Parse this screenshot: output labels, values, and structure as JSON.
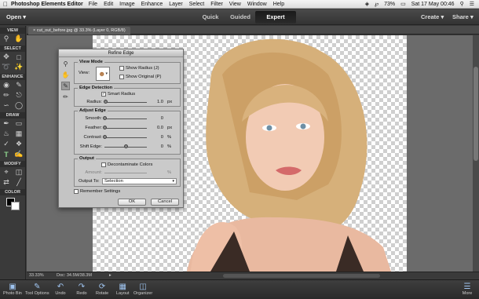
{
  "menubar": {
    "app_name": "Photoshop Elements Editor",
    "items": [
      "File",
      "Edit",
      "Image",
      "Enhance",
      "Layer",
      "Select",
      "Filter",
      "View",
      "Window",
      "Help"
    ],
    "battery": "73%",
    "datetime": "Sat 17 May  00:46"
  },
  "topbar": {
    "open_label": "Open",
    "modes": [
      "Quick",
      "Guided",
      "Expert"
    ],
    "active_mode": "Expert",
    "create_label": "Create",
    "share_label": "Share"
  },
  "tools": {
    "sections": {
      "view": "VIEW",
      "select": "SELECT",
      "enhance": "ENHANCE",
      "draw": "DRAW",
      "modify": "MODIFY",
      "color": "COLOR"
    }
  },
  "document": {
    "tab_title": "cut_out_before.jpg @ 33.3% (Layer 0, RGB/8)"
  },
  "status": {
    "zoom": "33.33%",
    "doc_size": "Doc: 34.5M/38.3M"
  },
  "taskbar": {
    "items": [
      "Photo Bin",
      "Tool Options",
      "Undo",
      "Redo",
      "Rotate",
      "Layout",
      "Organizer"
    ],
    "more": "More"
  },
  "dialog": {
    "title": "Refine Edge",
    "view_mode": {
      "heading": "View Mode",
      "view_label": "View:",
      "show_radius": "Show Radius (J)",
      "show_original": "Show Original (P)"
    },
    "edge_detection": {
      "heading": "Edge Detection",
      "smart_radius": "Smart Radius",
      "radius_label": "Radius:",
      "radius_value": "1.0",
      "radius_unit": "px",
      "radius_level": 0.03
    },
    "adjust_edge": {
      "heading": "Adjust Edge",
      "smooth_label": "Smooth:",
      "smooth_value": "0",
      "feather_label": "Feather:",
      "feather_value": "0.0",
      "feather_unit": "px",
      "contrast_label": "Contrast:",
      "contrast_value": "0",
      "contrast_unit": "%",
      "shift_label": "Shift Edge:",
      "shift_value": "0",
      "shift_unit": "%",
      "shift_level": 0.5
    },
    "output": {
      "heading": "Output",
      "decontaminate": "Decontaminate Colors",
      "amount_label": "Amount:",
      "amount_unit": "%",
      "output_to_label": "Output To:",
      "output_to_value": "Selection"
    },
    "remember": "Remember Settings",
    "ok": "OK",
    "cancel": "Cancel"
  }
}
